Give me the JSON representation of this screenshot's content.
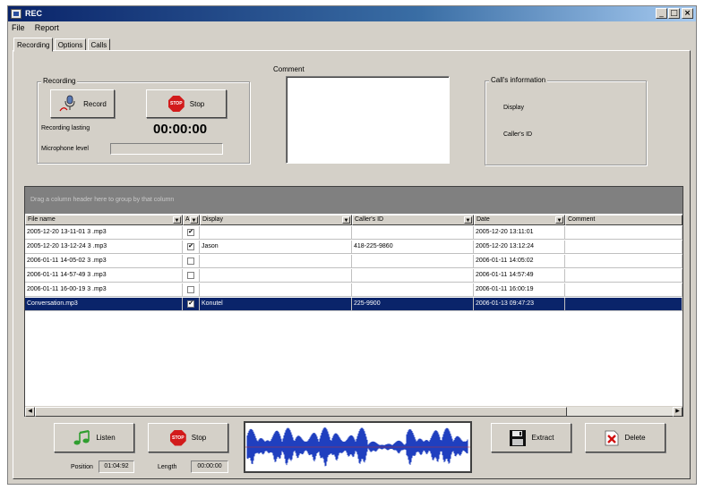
{
  "window": {
    "title": "REC"
  },
  "menu": [
    "File",
    "Report"
  ],
  "tabs": [
    "Recording",
    "Options",
    "Calls"
  ],
  "recording_group": {
    "title": "Recording",
    "record_label": "Record",
    "stop_label": "Stop",
    "stop_icon_text": "STOP",
    "lasting_label": "Recording lasting",
    "lasting_value": "00:00:00",
    "mic_label": "Microphone level"
  },
  "comment": {
    "label": "Comment"
  },
  "call_info": {
    "title": "Call's information",
    "display_label": "Display",
    "caller_id_label": "Caller's ID"
  },
  "grid": {
    "group_hint": "Drag a column header here to group by that column",
    "columns": [
      "File name",
      "A",
      "Display",
      "Caller's ID",
      "Date",
      "Comment"
    ],
    "rows": [
      {
        "file": "2005-12-20 13-11-01 3 .mp3",
        "checked": true,
        "display": "",
        "caller_id": "",
        "date": "2005-12-20 13:11:01"
      },
      {
        "file": "2005-12-20 13-12-24 3 .mp3",
        "checked": true,
        "display": "Jason",
        "caller_id": "418-225-9860",
        "date": "2005-12-20 13:12:24"
      },
      {
        "file": "2006-01-11 14-05-02 3 .mp3",
        "checked": false,
        "display": "",
        "caller_id": "",
        "date": "2006-01-11 14:05:02"
      },
      {
        "file": "2006-01-11 14-57-49 3 .mp3",
        "checked": false,
        "display": "",
        "caller_id": "",
        "date": "2006-01-11 14:57:49"
      },
      {
        "file": "2006-01-11 16-00-19 3 .mp3",
        "checked": false,
        "display": "",
        "caller_id": "",
        "date": "2006-01-11 16:00:19"
      },
      {
        "file": "Conversation.mp3",
        "checked": true,
        "display": "Konutel",
        "caller_id": "225-9900",
        "date": "2006-01-13 09:47:23"
      }
    ],
    "selected_row": 5
  },
  "bottom": {
    "listen_label": "Listen",
    "stop_label": "Stop",
    "stop_icon_text": "STOP",
    "position_label": "Position",
    "position_value": "01:04:92",
    "length_label": "Length",
    "length_value": "00:00:00",
    "extract_label": "Extract",
    "delete_label": "Delete"
  },
  "colors": {
    "title_gradient_start": "#0a246a",
    "selection": "#0a246a",
    "waveform": "#1f3fbf",
    "face": "#d4d0c8"
  }
}
